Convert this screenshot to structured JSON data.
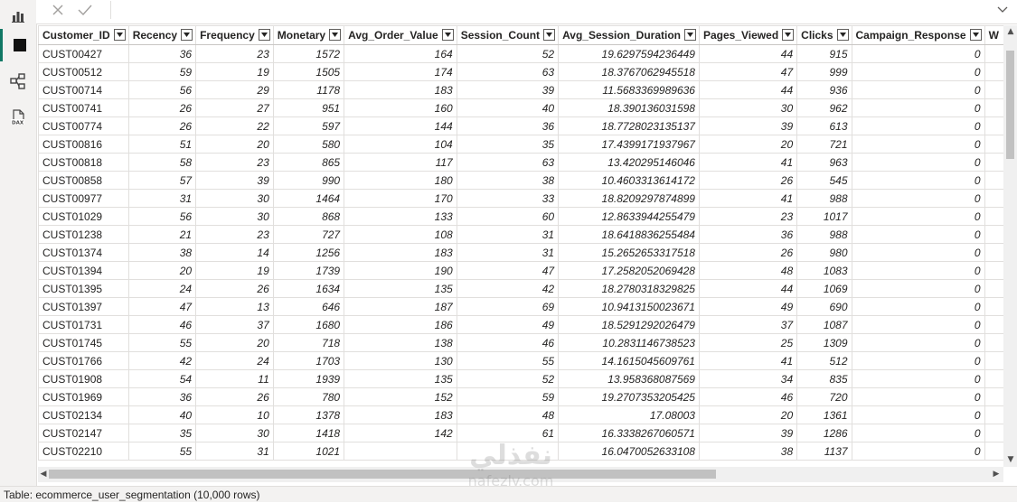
{
  "columns": [
    "Customer_ID",
    "Recency",
    "Frequency",
    "Monetary",
    "Avg_Order_Value",
    "Session_Count",
    "Avg_Session_Duration",
    "Pages_Viewed",
    "Clicks",
    "Campaign_Response",
    "W"
  ],
  "rows": [
    [
      "CUST00427",
      "36",
      "23",
      "1572",
      "164",
      "52",
      "19.6297594236449",
      "44",
      "915",
      "0"
    ],
    [
      "CUST00512",
      "59",
      "19",
      "1505",
      "174",
      "63",
      "18.3767062945518",
      "47",
      "999",
      "0"
    ],
    [
      "CUST00714",
      "56",
      "29",
      "1178",
      "183",
      "39",
      "11.5683369989636",
      "44",
      "936",
      "0"
    ],
    [
      "CUST00741",
      "26",
      "27",
      "951",
      "160",
      "40",
      "18.390136031598",
      "30",
      "962",
      "0"
    ],
    [
      "CUST00774",
      "26",
      "22",
      "597",
      "144",
      "36",
      "18.7728023135137",
      "39",
      "613",
      "0"
    ],
    [
      "CUST00816",
      "51",
      "20",
      "580",
      "104",
      "35",
      "17.4399171937967",
      "20",
      "721",
      "0"
    ],
    [
      "CUST00818",
      "58",
      "23",
      "865",
      "117",
      "63",
      "13.420295146046",
      "41",
      "963",
      "0"
    ],
    [
      "CUST00858",
      "57",
      "39",
      "990",
      "180",
      "38",
      "10.4603313614172",
      "26",
      "545",
      "0"
    ],
    [
      "CUST00977",
      "31",
      "30",
      "1464",
      "170",
      "33",
      "18.8209297874899",
      "41",
      "988",
      "0"
    ],
    [
      "CUST01029",
      "56",
      "30",
      "868",
      "133",
      "60",
      "12.8633944255479",
      "23",
      "1017",
      "0"
    ],
    [
      "CUST01238",
      "21",
      "23",
      "727",
      "108",
      "31",
      "18.6418836255484",
      "36",
      "988",
      "0"
    ],
    [
      "CUST01374",
      "38",
      "14",
      "1256",
      "183",
      "31",
      "15.2652653317518",
      "26",
      "980",
      "0"
    ],
    [
      "CUST01394",
      "20",
      "19",
      "1739",
      "190",
      "47",
      "17.2582052069428",
      "48",
      "1083",
      "0"
    ],
    [
      "CUST01395",
      "24",
      "26",
      "1634",
      "135",
      "42",
      "18.2780318329825",
      "44",
      "1069",
      "0"
    ],
    [
      "CUST01397",
      "47",
      "13",
      "646",
      "187",
      "69",
      "10.9413150023671",
      "49",
      "690",
      "0"
    ],
    [
      "CUST01731",
      "46",
      "37",
      "1680",
      "186",
      "49",
      "18.5291292026479",
      "37",
      "1087",
      "0"
    ],
    [
      "CUST01745",
      "55",
      "20",
      "718",
      "138",
      "46",
      "10.2831146738523",
      "25",
      "1309",
      "0"
    ],
    [
      "CUST01766",
      "42",
      "24",
      "1703",
      "130",
      "55",
      "14.1615045609761",
      "41",
      "512",
      "0"
    ],
    [
      "CUST01908",
      "54",
      "11",
      "1939",
      "135",
      "52",
      "13.958368087569",
      "34",
      "835",
      "0"
    ],
    [
      "CUST01969",
      "36",
      "26",
      "780",
      "152",
      "59",
      "19.2707353205425",
      "46",
      "720",
      "0"
    ],
    [
      "CUST02134",
      "40",
      "10",
      "1378",
      "183",
      "48",
      "17.08003",
      "20",
      "1361",
      "0"
    ],
    [
      "CUST02147",
      "35",
      "30",
      "1418",
      "142",
      "61",
      "16.3338267060571",
      "39",
      "1286",
      "0"
    ],
    [
      "CUST02210",
      "55",
      "31",
      "1021",
      "",
      "",
      "16.0470052633108",
      "38",
      "1137",
      "0"
    ]
  ],
  "status_text": "Table: ecommerce_user_segmentation (10,000 rows)",
  "watermark": {
    "main": "نفذلي",
    "sub": "nafezly.com"
  },
  "icons": {
    "rail": [
      "report-view-icon",
      "table-view-icon",
      "model-view-icon",
      "dax-query-icon"
    ],
    "formula": [
      "cancel-icon",
      "commit-check-icon",
      "chevron-down-icon"
    ]
  },
  "colors": {
    "accent": "#117865",
    "grid_border": "#e1dfdd",
    "rail_bg": "#f3f2f1"
  }
}
